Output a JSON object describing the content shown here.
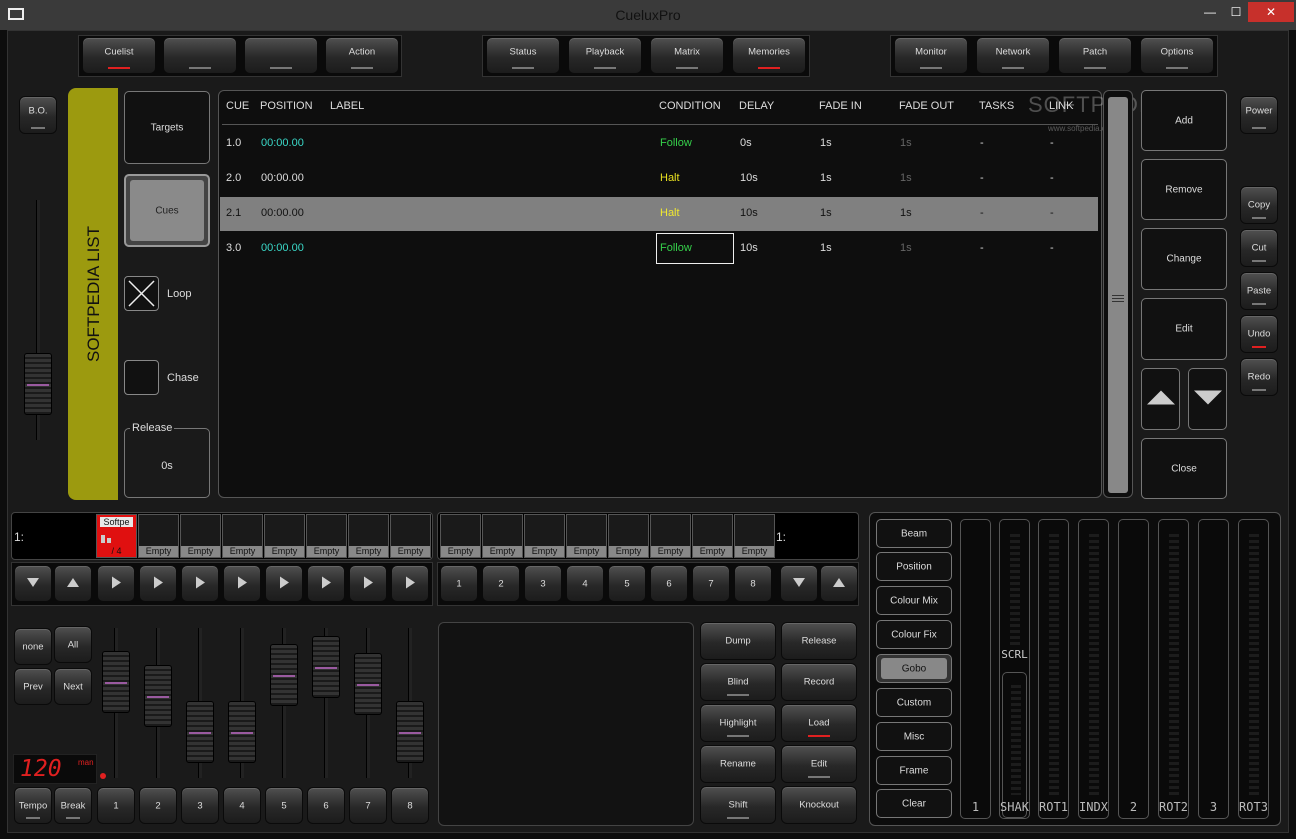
{
  "window": {
    "title": "CueluxPro",
    "minimize": "—",
    "maximize": "☐",
    "close": "✕"
  },
  "watermark": {
    "text": "SOFTPEDIA",
    "url": "www.softpedia.com"
  },
  "top_buttons": {
    "group1": [
      "Cuelist",
      "",
      "",
      "Action"
    ],
    "group2": [
      "Status",
      "Playback",
      "Matrix",
      "Memories"
    ],
    "group3": [
      "Monitor",
      "Network",
      "Patch",
      "Options"
    ]
  },
  "left": {
    "bo": "B.O."
  },
  "right": {
    "power": "Power",
    "edit_buttons": [
      "Copy",
      "Cut",
      "Paste",
      "Undo",
      "Redo"
    ]
  },
  "cuelist": {
    "title": "SOFTPEDIA LIST",
    "targets": "Targets",
    "cues": "Cues",
    "loop": "Loop",
    "chase": "Chase",
    "release_label": "Release",
    "release_value": "0s",
    "columns": [
      "CUE",
      "POSITION",
      "LABEL",
      "CONDITION",
      "DELAY",
      "FADE IN",
      "FADE OUT",
      "TASKS",
      "LINK"
    ],
    "rows": [
      {
        "cue": "1.0",
        "position": "00:00.00",
        "label": "",
        "condition": "Follow",
        "delay": "0s",
        "fade_in": "1s",
        "fade_out": "1s",
        "tasks": "-",
        "link": "-"
      },
      {
        "cue": "2.0",
        "position": "00:00.00",
        "label": "",
        "condition": "Halt",
        "delay": "10s",
        "fade_in": "1s",
        "fade_out": "1s",
        "tasks": "-",
        "link": "-"
      },
      {
        "cue": "2.1",
        "position": "00:00.00",
        "label": "",
        "condition": "Halt",
        "delay": "10s",
        "fade_in": "1s",
        "fade_out": "1s",
        "tasks": "-",
        "link": "-"
      },
      {
        "cue": "3.0",
        "position": "00:00.00",
        "label": "",
        "condition": "Follow",
        "delay": "10s",
        "fade_in": "1s",
        "fade_out": "1s",
        "tasks": "-",
        "link": "-"
      }
    ],
    "actions": [
      "Add",
      "Remove",
      "Change",
      "Edit",
      "Close"
    ]
  },
  "playback": {
    "left_page": "1:",
    "right_page": "1:",
    "active_slot": {
      "name": "Softpe",
      "count": "/ 4"
    },
    "empty_label": "Empty",
    "numbers": [
      "1",
      "2",
      "3",
      "4",
      "5",
      "6",
      "7",
      "8"
    ]
  },
  "faders": {
    "none": "none",
    "all": "All",
    "prev": "Prev",
    "next": "Next",
    "bpm": "120",
    "bpm_unit": "man",
    "tempo": "Tempo",
    "break": "Break",
    "numbers": [
      "1",
      "2",
      "3",
      "4",
      "5",
      "6",
      "7",
      "8"
    ],
    "levels": [
      0.72,
      0.6,
      0.3,
      0.3,
      0.78,
      0.85,
      0.7,
      0.3
    ]
  },
  "programmer": {
    "col1": [
      "Dump",
      "Blind",
      "Highlight",
      "Rename",
      "Shift"
    ],
    "col2": [
      "Release",
      "Record",
      "Load",
      "Edit",
      "Knockout"
    ]
  },
  "attributes": {
    "groups": [
      "Beam",
      "Position",
      "Colour Mix",
      "Colour Fix",
      "Gobo",
      "Custom",
      "Misc",
      "Frame",
      "Clear"
    ],
    "active": "Gobo",
    "strips": [
      "1",
      "SHAK",
      "ROT1",
      "INDX",
      "2",
      "ROT2",
      "3",
      "ROT3"
    ],
    "scrl": "SCRL"
  },
  "colors": {
    "accent_olive": "#9c9a0f",
    "follow": "#35d04a",
    "halt": "#e8e020",
    "time_cyan": "#3ad8c8",
    "red": "#e02020"
  }
}
